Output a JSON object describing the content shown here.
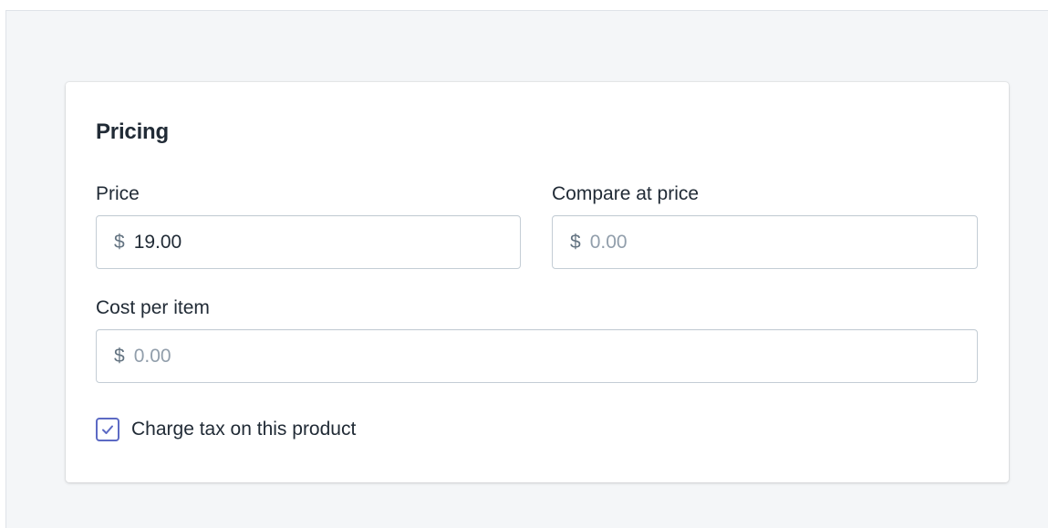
{
  "card": {
    "title": "Pricing"
  },
  "fields": {
    "price": {
      "label": "Price",
      "prefix": "$",
      "value": "19.00",
      "placeholder": ""
    },
    "compare_at_price": {
      "label": "Compare at price",
      "prefix": "$",
      "value": "",
      "placeholder": "0.00"
    },
    "cost_per_item": {
      "label": "Cost per item",
      "prefix": "$",
      "value": "",
      "placeholder": "0.00"
    }
  },
  "tax": {
    "label": "Charge tax on this product",
    "checked": true,
    "icon": "checkmark-icon"
  },
  "colors": {
    "accent": "#5c6ac4",
    "background": "#f4f6f8",
    "border": "#c4cdd5",
    "text": "#212b36",
    "placeholder": "#919eab"
  }
}
